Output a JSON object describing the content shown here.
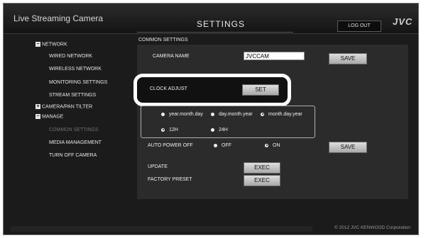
{
  "header": {
    "app_title": "Live Streaming Camera",
    "page_title": "SETTINGS",
    "logout_label": "LOG OUT",
    "brand": "JVC"
  },
  "sidebar": {
    "network_group": "NETWORK",
    "network_items": [
      "WIRED NETWORK",
      "WIRELESS NETWORK",
      "MONITORING SETTINGS",
      "STREAM SETTINGS"
    ],
    "camera_group": "CAMERA/PAN TILTER",
    "manage_group": "MANAGE",
    "manage_items": [
      "COMMON SETTINGS",
      "MEDIA MANAGEMENT",
      "TURN OFF CAMERA"
    ]
  },
  "content": {
    "section_title": "COMMON SETTINGS",
    "camera_name_label": "CAMERA NAME",
    "camera_name_value": "JVCCAM",
    "save_label": "SAVE",
    "clock_adjust_label": "CLOCK ADJUST",
    "set_label": "SET",
    "date_formats": {
      "ymd": "year.month.day",
      "dmy": "day.month.year",
      "mdy": "month.day.year",
      "selected": "month.day.year"
    },
    "time_formats": {
      "h12": "12H",
      "h24": "24H",
      "selected": "12H"
    },
    "auto_power_off_label": "AUTO POWER OFF",
    "off_label": "OFF",
    "on_label": "ON",
    "auto_power_off_selected": "ON",
    "update_label": "UPDATE",
    "factory_preset_label": "FACTORY PRESET",
    "exec_label": "EXEC"
  },
  "footer": {
    "copyright": "© 2012 JVC KENWOOD Corporation"
  }
}
